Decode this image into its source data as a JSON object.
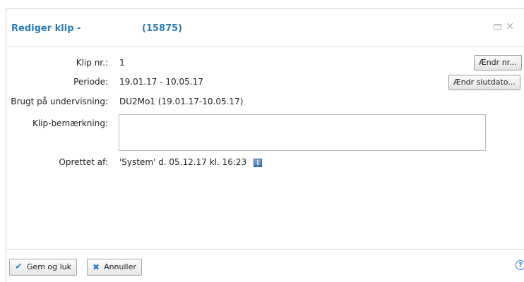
{
  "dialog": {
    "title": "Rediger klip -",
    "title_id": "(15875)"
  },
  "fields": {
    "klip_nr_label": "Klip nr.:",
    "klip_nr_value": "1",
    "periode_label": "Periode:",
    "periode_value": "19.01.17 - 10.05.17",
    "brugt_label": "Brugt på undervisning:",
    "brugt_value": "DU2Mo1 (19.01.17-10.05.17)",
    "bemaerkning_label": "Klip-bemærkning:",
    "bemaerkning_value": "",
    "oprettet_label": "Oprettet af:",
    "oprettet_value": "'System' d. 05.12.17 kl. 16:23"
  },
  "buttons": {
    "aendr_nr": "Ændr nr...",
    "aendr_slutdato": "Ændr slutdato...",
    "gem_og_luk": "Gem og luk",
    "annuller": "Annuller"
  },
  "icons": {
    "maximize": "maximize-icon",
    "close": "close-icon",
    "info": "info-icon",
    "check": "check-icon",
    "cancel": "x-icon",
    "help": "help-icon"
  }
}
